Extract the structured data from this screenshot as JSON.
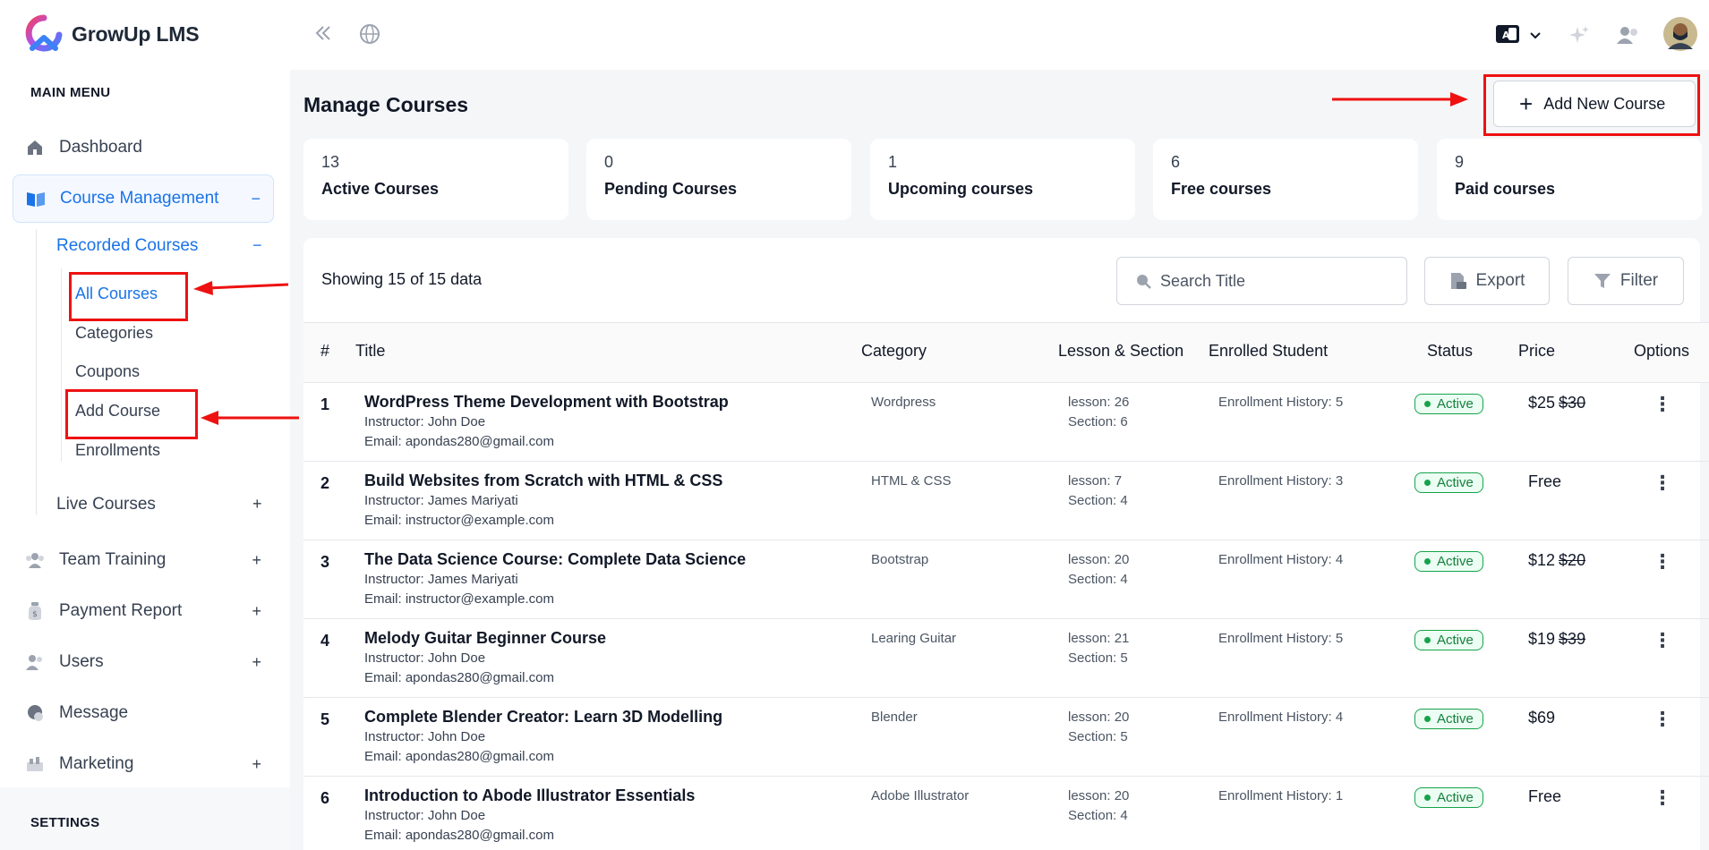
{
  "app": {
    "name": "GrowUp LMS"
  },
  "colors": {
    "accent": "#1a73e8",
    "active_badge": "#16a34a",
    "annotation": "#ee1111"
  },
  "sidebar": {
    "main_menu_heading": "MAIN MENU",
    "settings_heading": "SETTINGS",
    "items": [
      {
        "label": "Dashboard",
        "icon": "home-icon",
        "toggle": ""
      },
      {
        "label": "Course Management",
        "icon": "book-icon",
        "toggle": "−"
      },
      {
        "label": "Team Training",
        "icon": "team-icon",
        "toggle": "+"
      },
      {
        "label": "Payment Report",
        "icon": "money-bag-icon",
        "toggle": "+"
      },
      {
        "label": "Users",
        "icon": "users-icon",
        "toggle": "+"
      },
      {
        "label": "Message",
        "icon": "message-icon",
        "toggle": ""
      },
      {
        "label": "Marketing",
        "icon": "megaphone-icon",
        "toggle": "+"
      }
    ],
    "recorded_courses": {
      "label": "Recorded Courses",
      "toggle": "−"
    },
    "live_courses": {
      "label": "Live Courses",
      "toggle": "+"
    },
    "recorded_children": [
      "All Courses",
      "Categories",
      "Coupons",
      "Add Course",
      "Enrollments"
    ]
  },
  "header": {
    "icons": [
      "collapse-icon",
      "globe-icon",
      "translate-icon",
      "chevron-down-icon",
      "sparkle-icon",
      "user-switch-icon",
      "avatar"
    ]
  },
  "page": {
    "title": "Manage Courses",
    "add_button": "Add New Course"
  },
  "stats": [
    {
      "value": "13",
      "label": "Active Courses"
    },
    {
      "value": "0",
      "label": "Pending Courses"
    },
    {
      "value": "1",
      "label": "Upcoming courses"
    },
    {
      "value": "6",
      "label": "Free courses"
    },
    {
      "value": "9",
      "label": "Paid courses"
    }
  ],
  "table": {
    "showing": "Showing 15 of 15 data",
    "search_placeholder": "Search Title",
    "export_label": "Export",
    "filter_label": "Filter",
    "columns": [
      "#",
      "Title",
      "Category",
      "Lesson & Section",
      "Enrolled Student",
      "Status",
      "Price",
      "Options"
    ],
    "rows": [
      {
        "num": "1",
        "title": "WordPress Theme Development with Bootstrap",
        "instructor": "Instructor: John Doe",
        "email": "Email: apondas280@gmail.com",
        "category": "Wordpress",
        "lesson": "lesson: 26",
        "section": "Section: 6",
        "enrolled": "Enrollment History: 5",
        "status": "Active",
        "price": "$25",
        "old_price": "$30"
      },
      {
        "num": "2",
        "title": "Build Websites from Scratch with HTML & CSS",
        "instructor": "Instructor: James Mariyati",
        "email": "Email: instructor@example.com",
        "category": "HTML & CSS",
        "lesson": "lesson: 7",
        "section": "Section: 4",
        "enrolled": "Enrollment History: 3",
        "status": "Active",
        "price": "Free",
        "old_price": ""
      },
      {
        "num": "3",
        "title": "The Data Science Course: Complete Data Science",
        "instructor": "Instructor: James Mariyati",
        "email": "Email: instructor@example.com",
        "category": "Bootstrap",
        "lesson": "lesson: 20",
        "section": "Section: 4",
        "enrolled": "Enrollment History: 4",
        "status": "Active",
        "price": "$12",
        "old_price": "$20"
      },
      {
        "num": "4",
        "title": "Melody Guitar Beginner Course",
        "instructor": "Instructor: John Doe",
        "email": "Email: apondas280@gmail.com",
        "category": "Learing Guitar",
        "lesson": "lesson: 21",
        "section": "Section: 5",
        "enrolled": "Enrollment History: 5",
        "status": "Active",
        "price": "$19",
        "old_price": "$39"
      },
      {
        "num": "5",
        "title": "Complete Blender Creator: Learn 3D Modelling",
        "instructor": "Instructor: John Doe",
        "email": "Email: apondas280@gmail.com",
        "category": "Blender",
        "lesson": "lesson: 20",
        "section": "Section: 5",
        "enrolled": "Enrollment History: 4",
        "status": "Active",
        "price": "$69",
        "old_price": ""
      },
      {
        "num": "6",
        "title": "Introduction to Abode Illustrator Essentials",
        "instructor": "Instructor: John Doe",
        "email": "Email: apondas280@gmail.com",
        "category": "Adobe Illustrator",
        "lesson": "lesson: 20",
        "section": "Section: 4",
        "enrolled": "Enrollment History: 1",
        "status": "Active",
        "price": "Free",
        "old_price": ""
      }
    ],
    "options_glyph": "⋮"
  }
}
